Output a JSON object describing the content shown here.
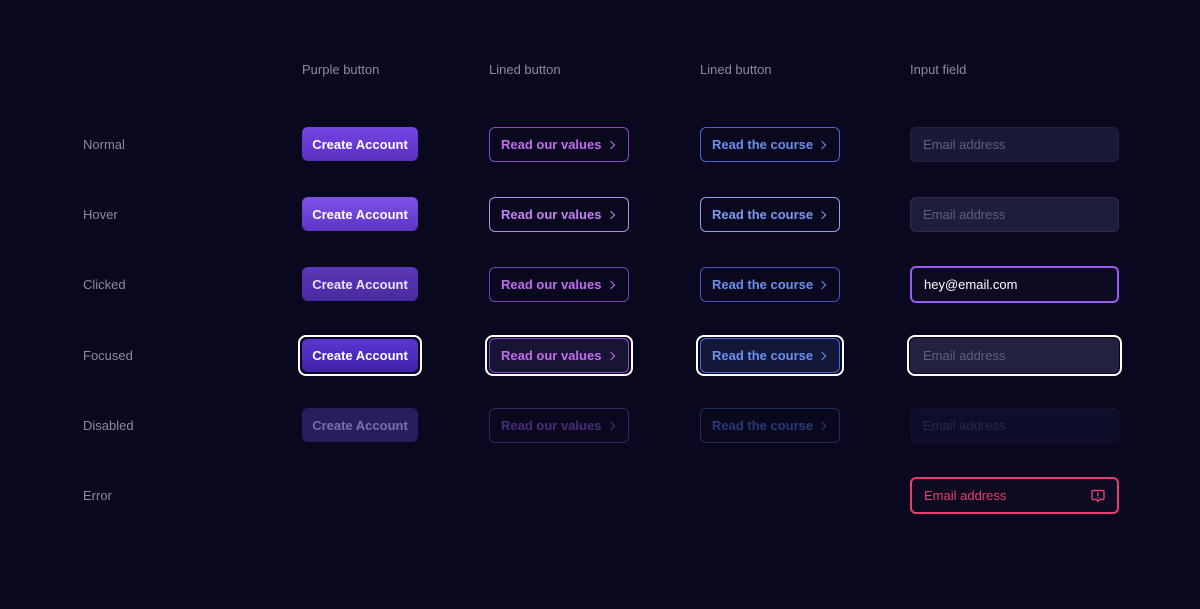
{
  "columns": [
    "Purple button",
    "Lined button",
    "Lined button",
    "Input field"
  ],
  "rows": [
    "Normal",
    "Hover",
    "Clicked",
    "Focused",
    "Disabled",
    "Error"
  ],
  "purple_label": "Create Account",
  "values_label": "Read our values",
  "course_label": "Read the course",
  "input_placeholder": "Email address",
  "input_clicked_value": "hey@email.com",
  "colors": {
    "background": "#09081f",
    "purple": "#6d3fd6",
    "values_text": "#c36cf0",
    "course_text": "#6b8ff0",
    "error": "#e83e6e"
  },
  "icons": {
    "chevron": "chevron-right-icon",
    "error": "alert-icon"
  }
}
